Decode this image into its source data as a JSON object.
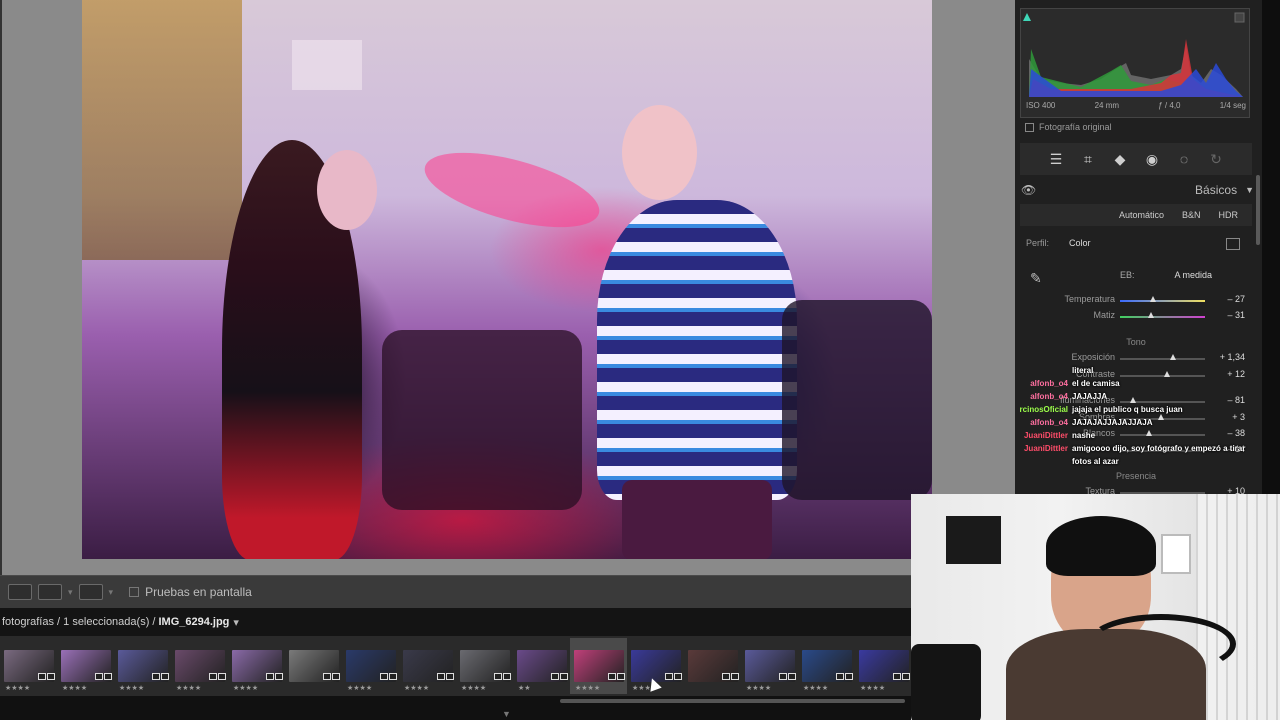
{
  "histogram": {
    "iso": "ISO 400",
    "focal": "24 mm",
    "aperture": "ƒ / 4,0",
    "shutter": "1/4 seg"
  },
  "original_label": "Fotografía original",
  "panel": {
    "section_title": "Básicos",
    "modes": [
      "Automático",
      "B&N",
      "HDR"
    ],
    "profile_label": "Perfil:",
    "profile_value": "Color",
    "eb_label": "EB:",
    "eb_value": "A medida",
    "temperature_label": "Temperatura",
    "temperature_value": "– 27",
    "tint_label": "Matiz",
    "tint_value": "– 31",
    "tone_title": "Tono",
    "exposure_label": "Exposición",
    "exposure_value": "+ 1,34",
    "contrast_label": "Contraste",
    "contrast_value": "+ 12",
    "highlights_label": "Iluminaciones",
    "highlights_value": "– 81",
    "shadows_label": "Sombras",
    "shadows_value": "+ 3",
    "whites_label": "Blancos",
    "whites_value": "– 38",
    "blacks_value": "– 14",
    "presence_title": "Presencia",
    "texture_label": "Textura",
    "texture_value": "+ 10"
  },
  "chat": [
    {
      "user": "",
      "msg": "literal",
      "color": "#ff6fa0"
    },
    {
      "user": "alfonb_o4",
      "msg": "el de camisa",
      "color": "#ff6fa0"
    },
    {
      "user": "alfonb_o4",
      "msg": "JAJAJJA",
      "color": "#ff6fa0"
    },
    {
      "user": "rcinosOficial",
      "msg": "jajaja el publico q busca juan",
      "color": "#9cff4a"
    },
    {
      "user": "alfonb_o4",
      "msg": "JAJAJAJJAJAJJAJA",
      "color": "#ff6fa0"
    },
    {
      "user": "JuaniDittler",
      "msg": "nashe",
      "color": "#ff4d6a"
    },
    {
      "user": "JuaniDittler",
      "msg": "amigoooo dijo, soy fotógrafo y empezó a tirar fotos al azar",
      "color": "#ff4d6a"
    }
  ],
  "toolbar": {
    "proof_label": "Pruebas en pantalla"
  },
  "filmstrip": {
    "path_prefix": "fotografías / 1 seleccionada(s) /",
    "filename": "IMG_6294.jpg",
    "dropdown": "▾",
    "thumbs": [
      {
        "stars": "★★★★",
        "color": "#7a6a80"
      },
      {
        "stars": "★★★★",
        "color": "#9a70b8"
      },
      {
        "stars": "★★★★",
        "color": "#5a5a9a"
      },
      {
        "stars": "★★★★",
        "color": "#6a4a6a"
      },
      {
        "stars": "★★★★",
        "color": "#8a6aa8"
      },
      {
        "stars": "",
        "color": "#7a7a7a"
      },
      {
        "stars": "★★★★",
        "color": "#2a3a6a"
      },
      {
        "stars": "★★★★",
        "color": "#3a3a4a"
      },
      {
        "stars": "★★★★",
        "color": "#6a6a70"
      },
      {
        "stars": "★★",
        "color": "#6a4a8a"
      },
      {
        "stars": "★★★★",
        "color": "#c0407a"
      },
      {
        "stars": "★★★",
        "color": "#3a3a9a"
      },
      {
        "stars": "",
        "color": "#5a3a3a"
      },
      {
        "stars": "★★★★",
        "color": "#5a5a9a"
      },
      {
        "stars": "★★★★",
        "color": "#2a4a8a"
      },
      {
        "stars": "★★★★",
        "color": "#3a3aa0"
      }
    ]
  }
}
